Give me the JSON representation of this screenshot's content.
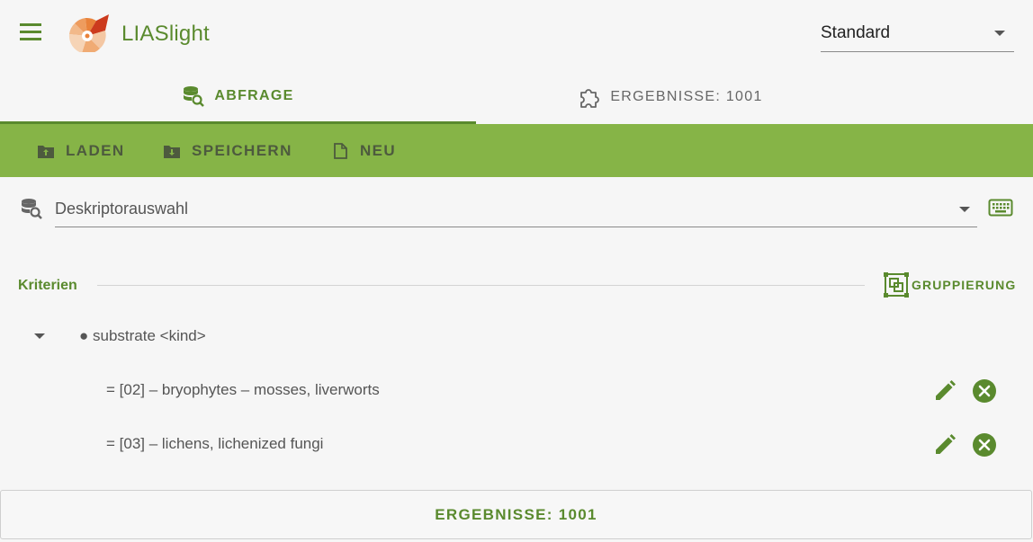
{
  "header": {
    "app_title": "LIASlight",
    "profile_select": {
      "value": "Standard"
    }
  },
  "tabs": [
    {
      "label": "ABFRAGE",
      "icon": "database-search-icon",
      "active": true
    },
    {
      "label": "ERGEBNISSE: 1001",
      "icon": "puzzle-icon",
      "active": false
    }
  ],
  "toolbar": {
    "load_label": "LADEN",
    "save_label": "SPEICHERN",
    "new_label": "NEU"
  },
  "descriptor": {
    "placeholder": "Deskriptorauswahl"
  },
  "criteria": {
    "label": "Kriterien",
    "group_button": "GRUPPIERUNG",
    "node": "● substrate <kind>",
    "items": [
      {
        "text": "= [02] – bryophytes – mosses, liverworts"
      },
      {
        "text": "= [03] – lichens, lichenized fungi"
      }
    ]
  },
  "results_button": "ERGEBNISSE: 1001",
  "colors": {
    "accent": "#5a8a2e",
    "toolbar_bg": "#86b447",
    "background": "#f6f6f6"
  }
}
